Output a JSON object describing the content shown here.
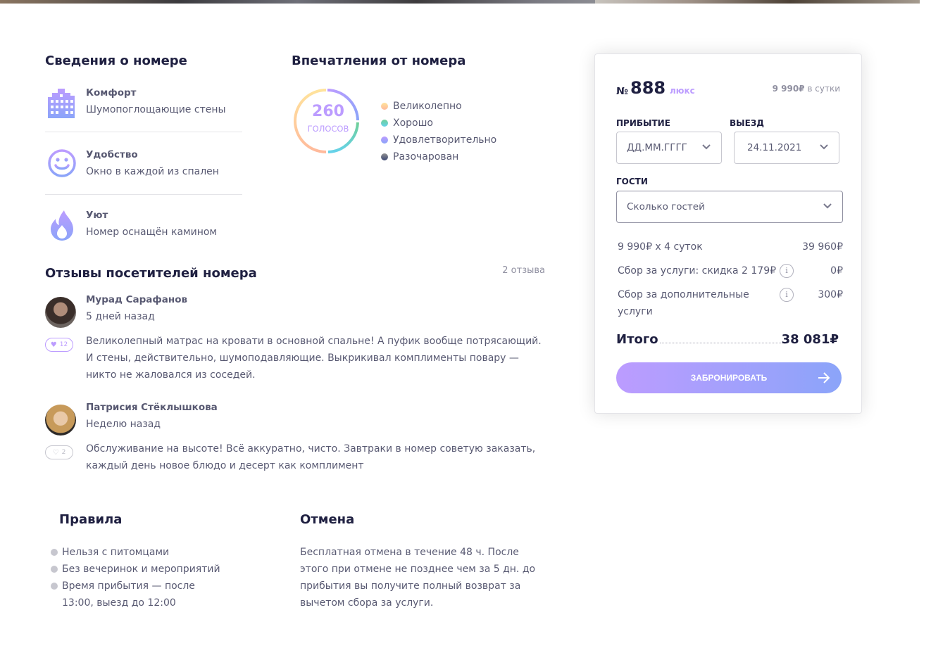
{
  "details": {
    "title": "Сведения о номере",
    "features": [
      {
        "icon": "building-icon",
        "title": "Комфорт",
        "desc": "Шумопоглощающие стены"
      },
      {
        "icon": "smile-icon",
        "title": "Удобство",
        "desc": "Окно в каждой из спален"
      },
      {
        "icon": "flame-icon",
        "title": "Уют",
        "desc": "Номер оснащён камином"
      }
    ]
  },
  "impressions": {
    "title": "Впечатления от номера",
    "count": "260",
    "count_label": "голосов",
    "legend": [
      {
        "label": "Великолепно",
        "color": "#ffe39c"
      },
      {
        "label": "Хорошо",
        "color": "#6fcf97"
      },
      {
        "label": "Удовлетворительно",
        "color": "#bc9cff"
      },
      {
        "label": "Разочарован",
        "color": "#919191"
      }
    ]
  },
  "reviews": {
    "title": "Отзывы посетителей номера",
    "count": "2 отзыва",
    "items": [
      {
        "name": "Мурад Сарафанов",
        "date": "5 дней назад",
        "likes": "12",
        "liked": true,
        "text": "Великолепный матрас на кровати в основной спальне! А пуфик вообще потрясающий. И стены, действительно, шумоподавляющие. Выкрикивал комплименты повару — никто не жаловался из соседей."
      },
      {
        "name": "Патрисия Стёклышкова",
        "date": "Неделю назад",
        "likes": "2",
        "liked": false,
        "text": "Обслуживание на высоте! Всё аккуратно, чисто. Завтраки в номер советую заказать, каждый день новое блюдо и десерт как комплимент"
      }
    ]
  },
  "rules": {
    "title": "Правила",
    "items": [
      "Нельзя с питомцами",
      "Без вечеринок и мероприятий",
      "Время прибытия — после 13:00, выезд до 12:00"
    ]
  },
  "cancel": {
    "title": "Отмена",
    "text": "Бесплатная отмена в течение 48 ч. После этого при отмене не позднее чем за 5 дн. до прибытия вы получите полный возврат за вычетом сбора за услуги."
  },
  "booking": {
    "number_sign": "№",
    "number": "888",
    "type": "люкс",
    "price": "9 990₽",
    "price_suffix": "в сутки",
    "arrival_label": "прибытие",
    "arrival_value": "ДД.ММ.ГГГГ",
    "departure_label": "выезд",
    "departure_value": "24.11.2021",
    "guests_label": "гости",
    "guests_value": "Сколько гостей",
    "calc": [
      {
        "label": "9 990₽ х 4 суток",
        "value": "39 960₽"
      },
      {
        "label": "Сбор за услуги: скидка 2 179₽",
        "value": "0₽"
      },
      {
        "label": "Сбор за дополнительные услуги",
        "value": "300₽"
      }
    ],
    "info_symbol": "i",
    "total_label": "Итого",
    "total_value": "38 081₽",
    "button_label": "забронировать",
    "colors": {
      "accent": "#bc9cff",
      "accent2": "#8ba4f9",
      "text": "#1f2041"
    }
  }
}
